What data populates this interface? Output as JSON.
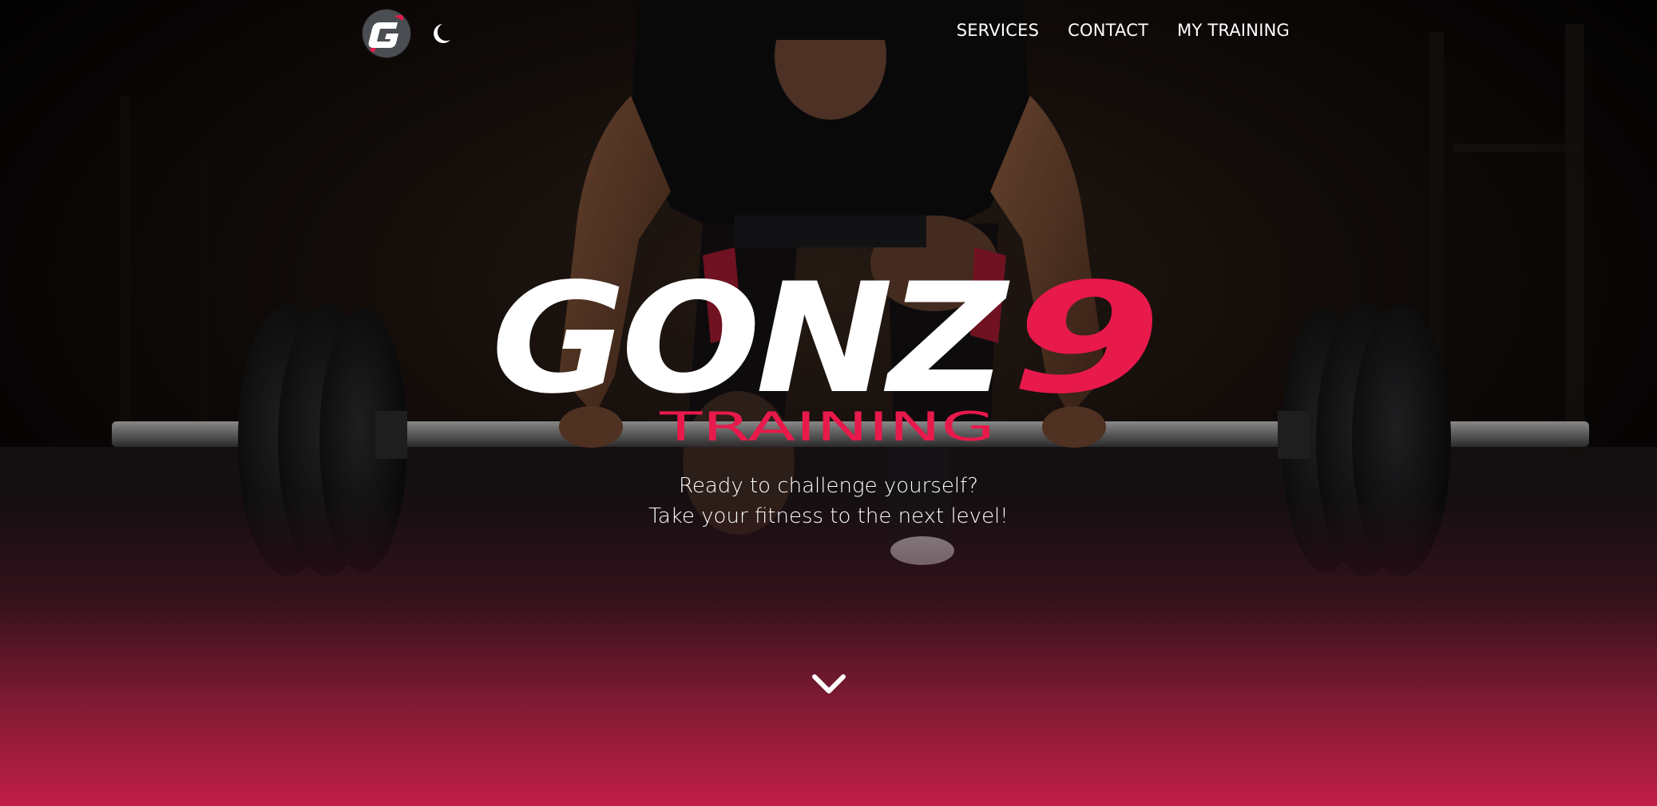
{
  "nav": {
    "brand_logo": "g-logo-icon",
    "theme_toggle": "moon-icon",
    "links": [
      {
        "label": "SERVICES"
      },
      {
        "label": "CONTACT"
      },
      {
        "label": "MY TRAINING"
      }
    ]
  },
  "hero": {
    "wordmark_main": "GONZ",
    "wordmark_accent": "9",
    "wordmark_sub": "TRAINING",
    "tagline_line1": "Ready to challenge yourself?",
    "tagline_line2": "Take your fitness to the next level!",
    "scroll_icon": "chevron-down-icon"
  },
  "colors": {
    "accent": "#e8194b",
    "bottom_gradient": "#c21f48",
    "text": "#ffffff",
    "logo_bg": "#4a4d52"
  }
}
